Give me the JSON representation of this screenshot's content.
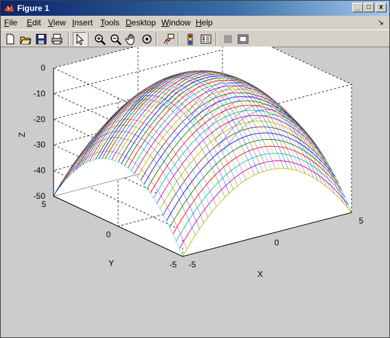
{
  "window": {
    "title": "Figure 1",
    "controls": {
      "minimize": "_",
      "maximize": "□",
      "close": "x"
    }
  },
  "menu": {
    "items": [
      {
        "label": "File",
        "accel": "F",
        "rest": "ile"
      },
      {
        "label": "Edit",
        "accel": "E",
        "rest": "dit"
      },
      {
        "label": "View",
        "accel": "V",
        "rest": "iew"
      },
      {
        "label": "Insert",
        "accel": "I",
        "rest": "nsert"
      },
      {
        "label": "Tools",
        "accel": "T",
        "rest": "ools"
      },
      {
        "label": "Desktop",
        "accel": "D",
        "rest": "esktop"
      },
      {
        "label": "Window",
        "accel": "W",
        "rest": "indow"
      },
      {
        "label": "Help",
        "accel": "H",
        "rest": "elp"
      }
    ],
    "dock_glyph": "↘"
  },
  "toolbar": {
    "tools": [
      {
        "name": "new-figure-icon"
      },
      {
        "name": "open-file-icon"
      },
      {
        "name": "save-icon"
      },
      {
        "name": "print-icon"
      },
      {
        "name": "edit-plot-arrow-icon",
        "pressed": true
      },
      {
        "name": "zoom-in-icon"
      },
      {
        "name": "zoom-out-icon"
      },
      {
        "name": "pan-hand-icon"
      },
      {
        "name": "rotate-3d-icon"
      },
      {
        "name": "data-cursor-icon"
      },
      {
        "name": "colorbar-icon"
      },
      {
        "name": "legend-icon"
      },
      {
        "name": "hide-plot-tools-icon"
      },
      {
        "name": "show-plot-tools-icon"
      }
    ]
  },
  "colors": {
    "figure_background": "#cccccc",
    "axes_background": "#ffffff",
    "title_active": "#0a246a",
    "line_colors": [
      "#0000ff",
      "#008000",
      "#ff0000",
      "#00bfbf",
      "#bf00bf",
      "#bfbf00",
      "#404040"
    ]
  },
  "chart_data": {
    "type": "surface-mesh",
    "function": "z = -x^2 - y^2",
    "x": {
      "label": "X",
      "range": [
        -5,
        5
      ],
      "ticks": [
        "-5",
        "0",
        "5"
      ]
    },
    "y": {
      "label": "Y",
      "range": [
        -5,
        5
      ],
      "ticks": [
        "-5",
        "0",
        "5"
      ]
    },
    "z": {
      "label": "Z",
      "range": [
        -50,
        0
      ],
      "ticks": [
        "-50",
        "-40",
        "-30",
        "-20",
        "-10",
        "0"
      ]
    },
    "grid": true,
    "box": true,
    "mesh_lines": 41
  }
}
